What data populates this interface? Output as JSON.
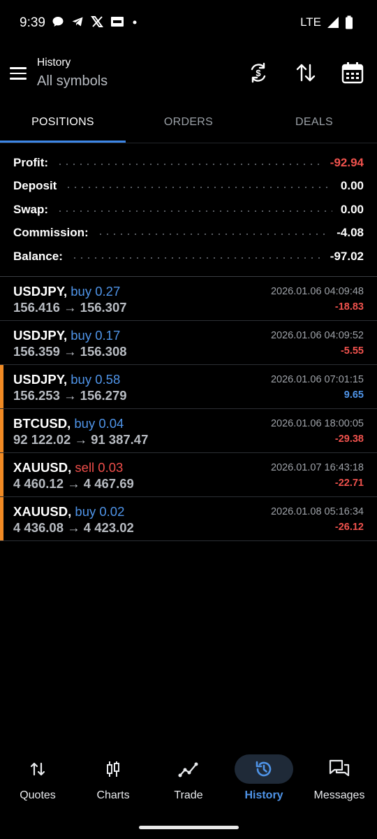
{
  "status_bar": {
    "time": "9:39",
    "network": "LTE"
  },
  "header": {
    "subtitle": "History",
    "title": "All symbols"
  },
  "tabs": [
    {
      "label": "POSITIONS",
      "active": true
    },
    {
      "label": "ORDERS",
      "active": false
    },
    {
      "label": "DEALS",
      "active": false
    }
  ],
  "summary": {
    "profit_label": "Profit:",
    "profit_value": "-92.94",
    "deposit_label": "Deposit",
    "deposit_value": "0.00",
    "swap_label": "Swap:",
    "swap_value": "0.00",
    "commission_label": "Commission:",
    "commission_value": "-4.08",
    "balance_label": "Balance:",
    "balance_value": "-97.02"
  },
  "deals": [
    {
      "symbol": "USDJPY,",
      "side": "buy 0.27",
      "prices": "156.416 → 156.307",
      "time": "2026.01.06 04:09:48",
      "pnl": "-18.83"
    },
    {
      "symbol": "USDJPY,",
      "side": "buy 0.17",
      "prices": "156.359 → 156.308",
      "time": "2026.01.06 04:09:52",
      "pnl": "-5.55"
    },
    {
      "symbol": "USDJPY,",
      "side": "buy 0.58",
      "prices": "156.253 → 156.279",
      "time": "2026.01.06 07:01:15",
      "pnl": "9.65"
    },
    {
      "symbol": "BTCUSD,",
      "side": "buy 0.04",
      "prices": "92 122.02 → 91 387.47",
      "time": "2026.01.06 18:00:05",
      "pnl": "-29.38"
    },
    {
      "symbol": "XAUUSD,",
      "side": "sell 0.03",
      "prices": "4 460.12 → 4 467.69",
      "time": "2026.01.07 16:43:18",
      "pnl": "-22.71"
    },
    {
      "symbol": "XAUUSD,",
      "side": "buy 0.02",
      "prices": "4 436.08 → 4 423.02",
      "time": "2026.01.08 05:16:34",
      "pnl": "-26.12"
    }
  ],
  "nav": {
    "quotes": "Quotes",
    "charts": "Charts",
    "trade": "Trade",
    "history": "History",
    "messages": "Messages"
  },
  "colors": {
    "accent": "#4f94e8",
    "negative": "#f0524d",
    "marker": "#f08a24",
    "background": "#000000"
  }
}
